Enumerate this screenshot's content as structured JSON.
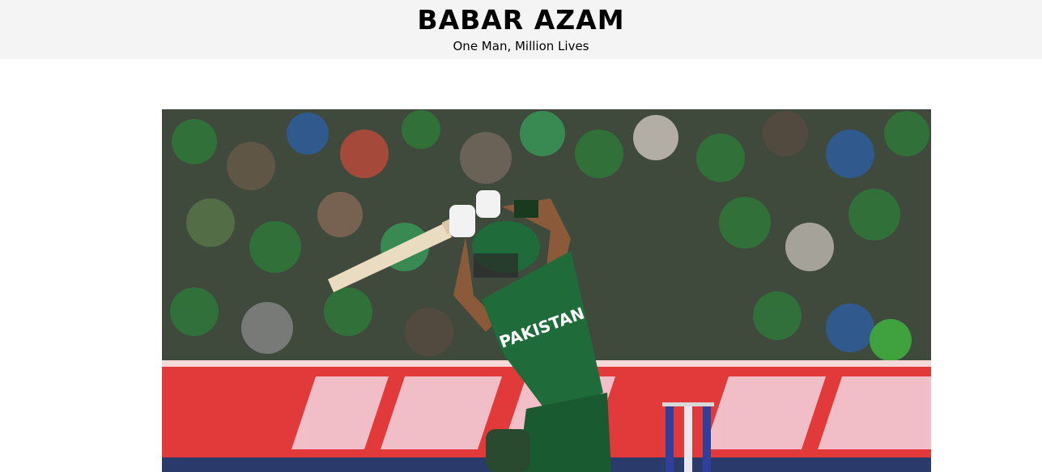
{
  "header": {
    "title": "BABAR AZAM",
    "subtitle": "One Man, Million Lives"
  },
  "hero": {
    "jersey_text": "PAKISTAN",
    "colors": {
      "crowd_base": "#3f4a3c",
      "jersey_green": "#1f6b3a",
      "board_red": "#e23a3a",
      "stumps_blue": "#2f3f9a"
    }
  }
}
